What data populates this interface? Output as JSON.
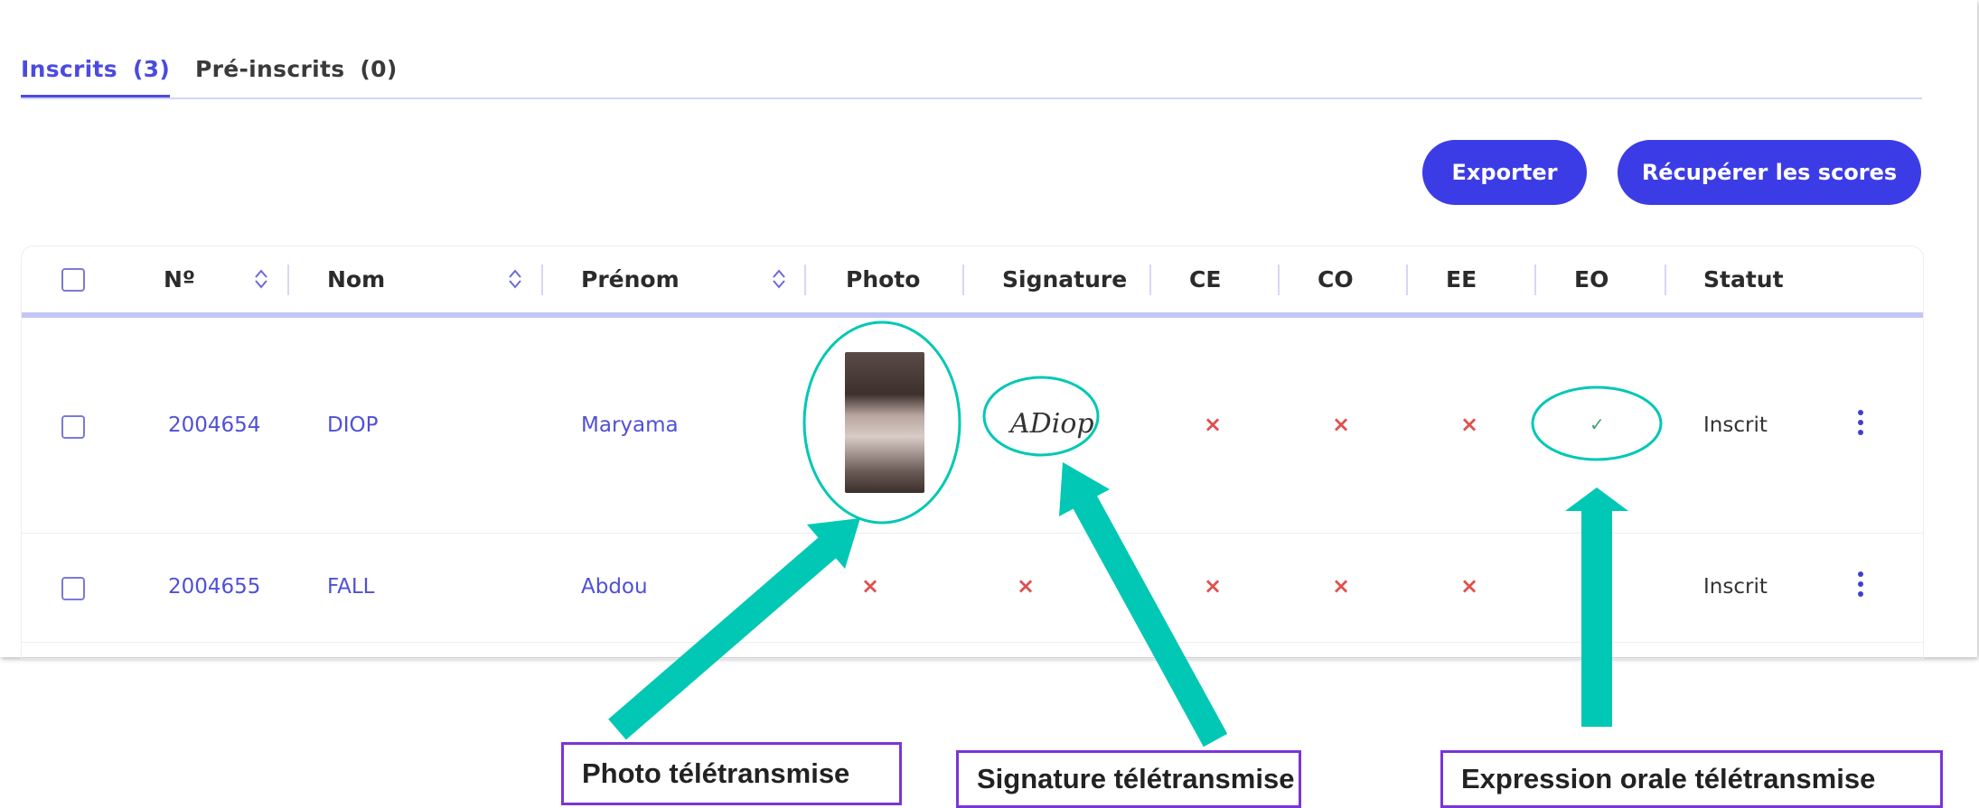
{
  "tabs": [
    {
      "label": "Inscrits",
      "count": "(3)"
    },
    {
      "label": "Pré-inscrits",
      "count": "(0)"
    }
  ],
  "buttons": {
    "export": "Exporter",
    "scores": "Récupérer les scores"
  },
  "table": {
    "headers": [
      "Nº",
      "Nom",
      "Prénom",
      "Photo",
      "Signature",
      "CE",
      "CO",
      "EE",
      "EO",
      "Statut"
    ],
    "rows": [
      {
        "no": "2004654",
        "nom": "DIOP",
        "prenom": "Maryama",
        "photo": true,
        "signature": true,
        "ce": "×",
        "co": "×",
        "ee": "×",
        "eo": "✓",
        "statut": "Inscrit"
      },
      {
        "no": "2004655",
        "nom": "FALL",
        "prenom": "Abdou",
        "photo": false,
        "signature": false,
        "photo_mark": "×",
        "signature_mark": "×",
        "ce": "×",
        "co": "×",
        "ee": "×",
        "eo": "",
        "statut": "Inscrit"
      }
    ]
  },
  "signature_text": "ADiop",
  "callouts": {
    "photo": "Photo télétransmise",
    "signature": "Signature télétransmise",
    "eo": "Expression orale télétransmise"
  },
  "icons": [
    "sort-icon",
    "checkbox-icon",
    "kebab-menu-icon",
    "close-icon",
    "check-icon",
    "arrow-icon"
  ],
  "colors": {
    "accent": "#3c3ce6",
    "annotation": "#00c8b4",
    "callout_border": "#7a35d6",
    "error": "#e05050",
    "success": "#40a070"
  }
}
